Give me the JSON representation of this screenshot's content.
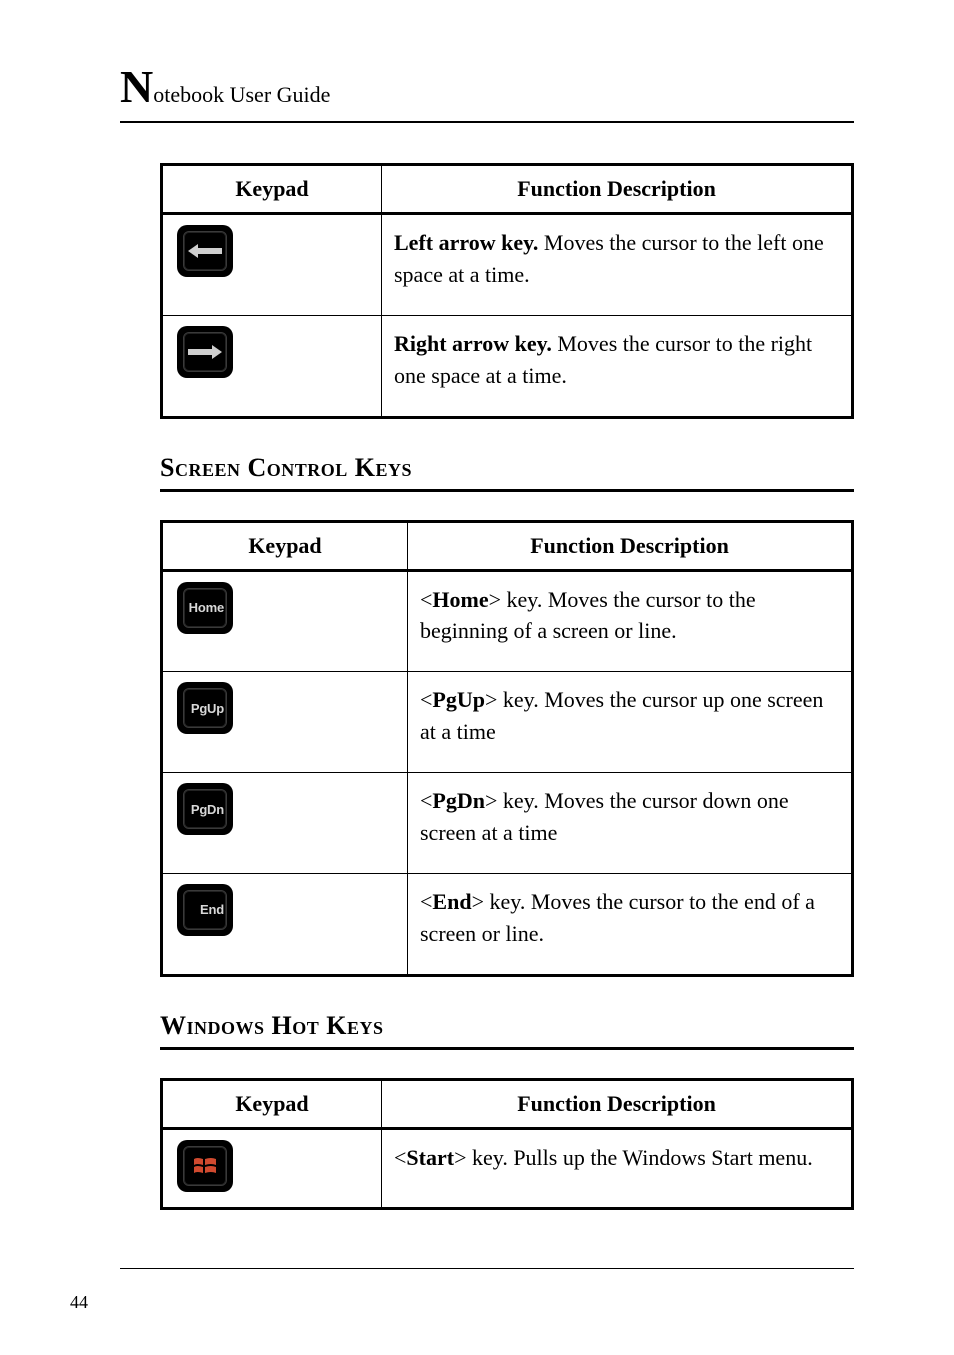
{
  "header": {
    "big_letter": "N",
    "rest": "otebook User Guide"
  },
  "tables": {
    "arrows": {
      "header_keypad": "Keypad",
      "header_desc": "Function Description",
      "rows": [
        {
          "bold": "Left arrow key.",
          "text": " Moves the cursor to the left one space at a time."
        },
        {
          "bold": "Right arrow key.",
          "text": " Moves the cursor to the right one space at a time."
        }
      ]
    },
    "screen": {
      "heading": "Screen Control Keys",
      "header_keypad": "Keypad",
      "header_desc": "Function Description",
      "rows": [
        {
          "key_label": "Home",
          "pre": "<",
          "tag": "Home",
          "post": "> key. Moves the cursor to the beginning of a screen or line."
        },
        {
          "key_label": "PgUp",
          "pre": "<",
          "tag": "PgUp",
          "post": "> key. Moves the cursor up one screen at a time"
        },
        {
          "key_label": "PgDn",
          "pre": "<",
          "tag": "PgDn",
          "post": "> key. Moves the cursor down one screen at a time"
        },
        {
          "key_label": "End",
          "pre": "<",
          "tag": "End",
          "post": "> key. Moves the cursor to the end of a screen or line."
        }
      ]
    },
    "windows": {
      "heading": "Windows Hot Keys",
      "header_keypad": "Keypad",
      "header_desc": "Function Description",
      "rows": [
        {
          "pre": "<",
          "tag": "Start",
          "post": "> key. Pulls up the Windows Start menu."
        }
      ]
    }
  },
  "page_number": "44"
}
